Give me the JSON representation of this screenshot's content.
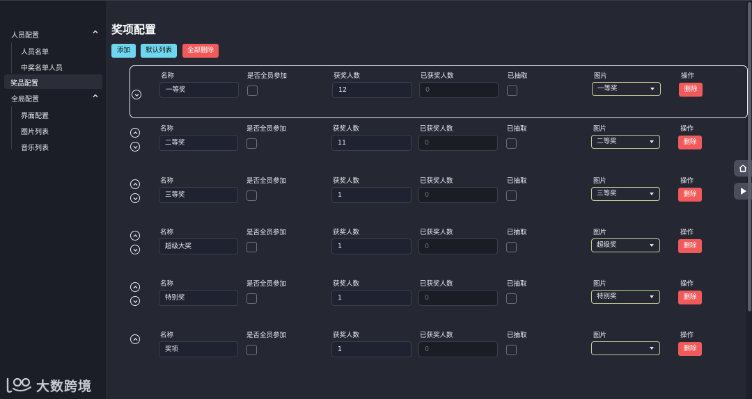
{
  "sidebar": {
    "groups": [
      {
        "label": "人员配置",
        "items": [
          "人员名单",
          "中奖名单人员"
        ]
      },
      {
        "label": "奖品配置",
        "active": true
      },
      {
        "label": "全局配置",
        "items": [
          "界面配置",
          "图片列表",
          "音乐列表"
        ]
      }
    ]
  },
  "page": {
    "title": "奖项配置",
    "buttons": {
      "add": "添加",
      "default_list": "默认列表",
      "delete_all": "全部删除"
    }
  },
  "columns": {
    "name": "名称",
    "all_members": "是否全员参加",
    "winner_count": "获奖人数",
    "won_count": "已获奖人数",
    "drawn": "已抽取",
    "image": "图片",
    "action": "操作"
  },
  "prizes": [
    {
      "name": "一等奖",
      "winner_count": "12",
      "won_count_placeholder": "0",
      "image": "一等奖",
      "delete_label": "删除"
    },
    {
      "name": "二等奖",
      "winner_count": "11",
      "won_count_placeholder": "0",
      "image": "二等奖",
      "delete_label": "删除"
    },
    {
      "name": "三等奖",
      "winner_count": "1",
      "won_count_placeholder": "0",
      "image": "三等奖",
      "delete_label": "删除"
    },
    {
      "name": "超级大奖",
      "winner_count": "1",
      "won_count_placeholder": "0",
      "image": "超级奖",
      "delete_label": "删除"
    },
    {
      "name": "特别奖",
      "winner_count": "1",
      "won_count_placeholder": "0",
      "image": "特别奖",
      "delete_label": "删除"
    },
    {
      "name": "奖项",
      "winner_count": "1",
      "won_count_placeholder": "0",
      "image": "",
      "delete_label": "删除"
    }
  ],
  "watermark": "大数跨境",
  "colors": {
    "accent_cyan": "#6fd6ef",
    "danger": "#f05a5a",
    "background": "#252833"
  }
}
